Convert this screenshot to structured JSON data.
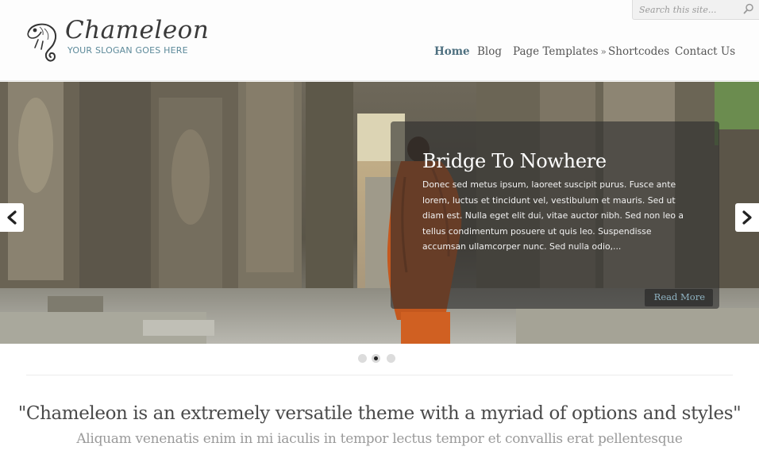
{
  "header": {
    "site_title": "Chameleon",
    "slogan": "YOUR SLOGAN GOES HERE",
    "logo_icon": "chameleon-logo-icon"
  },
  "search": {
    "placeholder": "Search this site...",
    "icon": "search-icon"
  },
  "nav": {
    "items": [
      {
        "label": "Home",
        "active": true
      },
      {
        "label": "Blog",
        "active": false
      },
      {
        "label": "Page Templates",
        "active": false,
        "has_submenu": true
      },
      {
        "label": "Shortcodes",
        "active": false
      },
      {
        "label": "Contact Us",
        "active": false
      }
    ],
    "submenu_arrow": "»"
  },
  "slider": {
    "slide_title": "Bridge To Nowhere",
    "slide_text": "Donec sed metus ipsum, laoreet suscipit purus. Fusce ante lorem, luctus et tincidunt vel, vestibulum et mauris. Sed ut diam est. Nulla eget elit dui, vitae auctor nibh. Sed non leo a tellus condimentum posuere ut quis leo. Suspendisse accumsan ullamcorper nunc. Sed nulla odio,...",
    "read_more_label": "Read More",
    "prev_icon": "chevron-left-icon",
    "next_icon": "chevron-right-icon",
    "dots_count": 3,
    "active_dot": 2
  },
  "intro": {
    "tagline": "\"Chameleon is an extremely versatile theme with a myriad of options and styles\"",
    "subtagline": "Aliquam venenatis enim in mi iaculis in tempor lectus tempor et convallis erat pellentesque"
  },
  "colors": {
    "accent": "#4d6f7f",
    "slogan": "#5d8a9a",
    "read_more": "#8fb3c2"
  }
}
